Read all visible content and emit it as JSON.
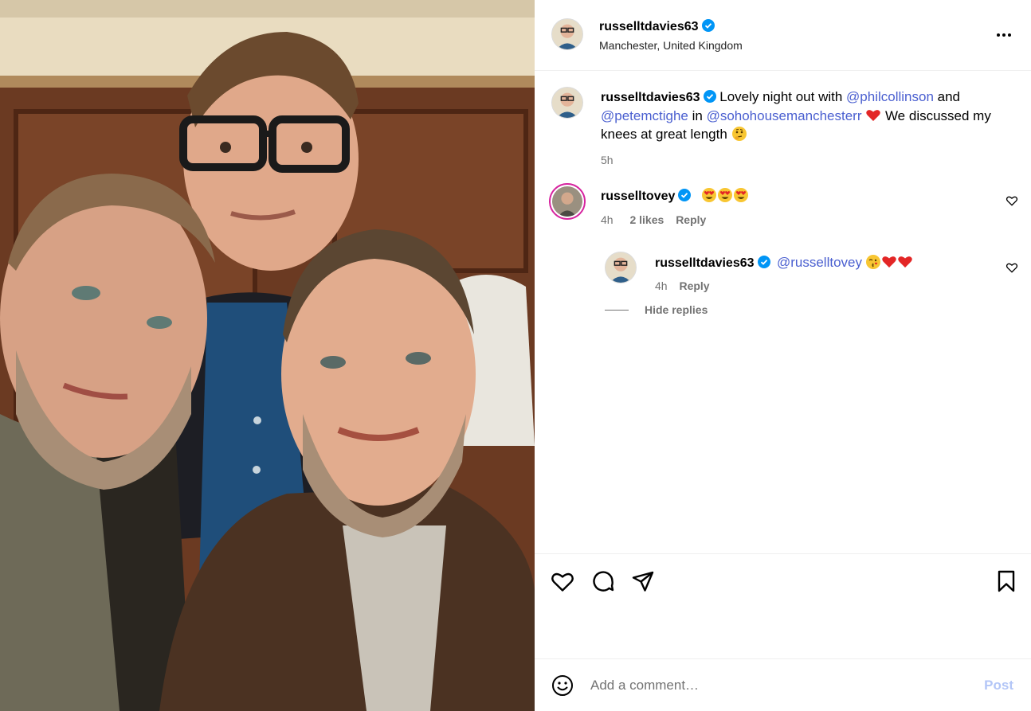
{
  "post": {
    "author": "russelltdavies63",
    "location": "Manchester, United Kingdom",
    "more_icon": "more-horizontal-icon"
  },
  "caption": {
    "author": "russelltdavies63",
    "text_1": "Lovely night out with ",
    "mention_1": "@philcollinson",
    "text_2": " and ",
    "mention_2": "@petemctighe",
    "text_3": " in ",
    "mention_3": "@sohohousemanchesterr",
    "text_4": " We discussed my knees at great length ",
    "time": "5h"
  },
  "comments": [
    {
      "author": "russelltovey",
      "text": "",
      "emojis": [
        "heart-eyes",
        "heart-eyes",
        "heart-eyes"
      ],
      "time": "4h",
      "likes": "2 likes",
      "reply_label": "Reply"
    }
  ],
  "reply": {
    "author": "russelltdavies63",
    "mention": "@russelltovey",
    "time": "4h",
    "reply_label": "Reply",
    "hide_replies": "Hide replies"
  },
  "actions": {
    "icons": [
      "heart-icon",
      "comment-icon",
      "share-icon",
      "bookmark-icon"
    ]
  },
  "comment_bar": {
    "placeholder": "Add a comment…",
    "post_label": "Post"
  },
  "colors": {
    "mention": "#4a5fd0",
    "verified": "#0095f6",
    "post_disabled": "#b3c6f7",
    "muted": "#737373"
  }
}
